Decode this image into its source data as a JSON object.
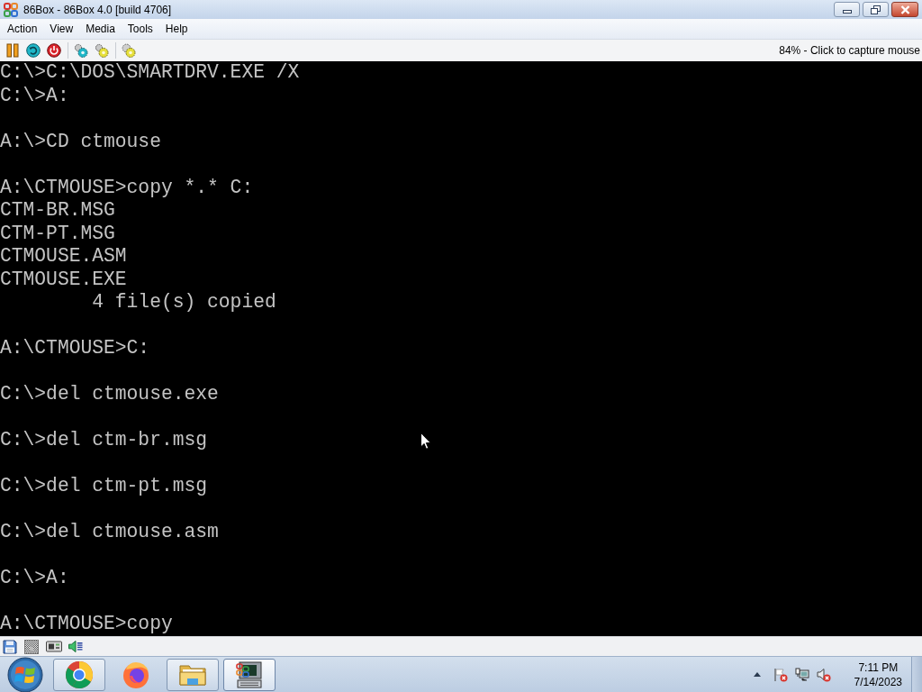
{
  "window": {
    "title": "86Box - 86Box 4.0 [build 4706]"
  },
  "menu": [
    "Action",
    "View",
    "Media",
    "Tools",
    "Help"
  ],
  "toolbar": {
    "status": "84% - Click to capture mouse"
  },
  "screen": {
    "blocks": [
      [
        "C:\\>C:\\DOS\\SMARTDRV.EXE /X",
        "C:\\>A:"
      ],
      [
        "A:\\>CD ctmouse"
      ],
      [
        "A:\\CTMOUSE>copy *.* C:",
        "CTM-BR.MSG",
        "CTM-PT.MSG",
        "CTMOUSE.ASM",
        "CTMOUSE.EXE",
        "        4 file(s) copied"
      ],
      [
        "A:\\CTMOUSE>C:"
      ],
      [
        "C:\\>del ctmouse.exe"
      ],
      [
        "C:\\>del ctm-br.msg"
      ],
      [
        "C:\\>del ctm-pt.msg"
      ],
      [
        "C:\\>del ctmouse.asm"
      ],
      [
        "C:\\>A:"
      ],
      [
        "A:\\CTMOUSE>copy"
      ]
    ]
  },
  "taskbar": {
    "apps": [
      {
        "kind": "browser",
        "running": true,
        "selected": false
      },
      {
        "kind": "fox",
        "running": false,
        "selected": false
      },
      {
        "kind": "folder",
        "running": true,
        "selected": false
      },
      {
        "kind": "computer",
        "running": true,
        "selected": true
      }
    ],
    "clock": {
      "time": "7:11 PM",
      "date": "7/14/2023"
    }
  }
}
